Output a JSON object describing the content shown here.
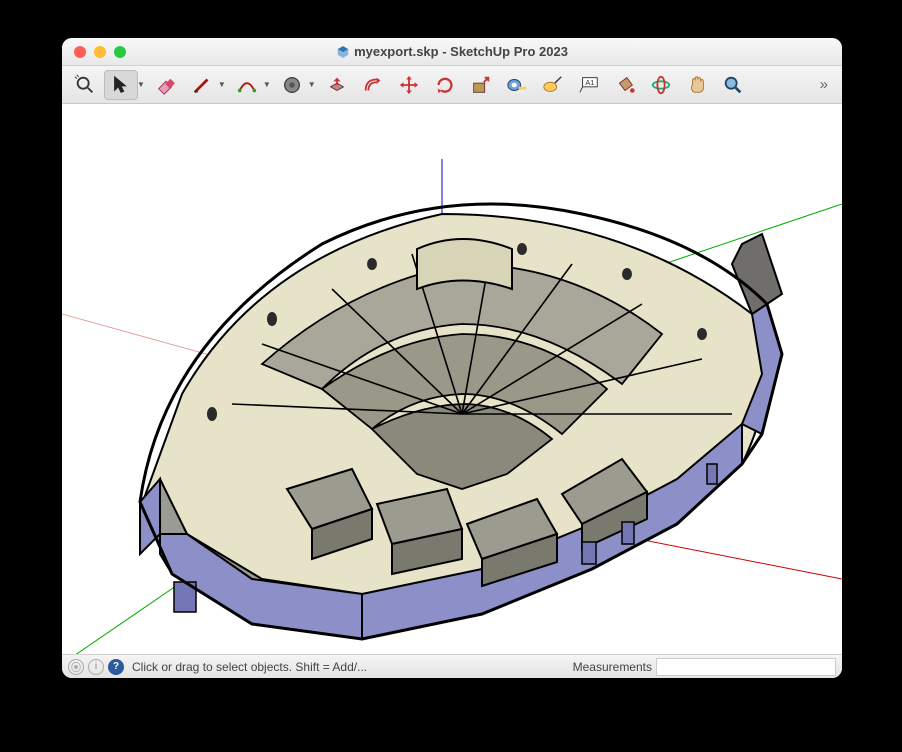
{
  "window": {
    "title": "myexport.skp - SketchUp Pro 2023"
  },
  "toolbar": {
    "tools": [
      {
        "name": "search-icon"
      },
      {
        "name": "select-icon",
        "selected": true,
        "hasDropdown": true
      },
      {
        "name": "eraser-icon"
      },
      {
        "name": "line-icon",
        "hasDropdown": true
      },
      {
        "name": "arc-icon",
        "hasDropdown": true
      },
      {
        "name": "shapes-icon",
        "hasDropdown": true
      },
      {
        "name": "pushpull-icon"
      },
      {
        "name": "offset-icon"
      },
      {
        "name": "move-icon"
      },
      {
        "name": "rotate-icon"
      },
      {
        "name": "scale-icon"
      },
      {
        "name": "tape-icon"
      },
      {
        "name": "dimension-icon"
      },
      {
        "name": "text-icon"
      },
      {
        "name": "paint-icon"
      },
      {
        "name": "orbit-icon"
      },
      {
        "name": "pan-icon"
      },
      {
        "name": "zoom-icon"
      }
    ]
  },
  "status": {
    "hint": "Click or drag to select objects. Shift = Add/...",
    "measurements_label": "Measurements",
    "measurements_value": ""
  }
}
